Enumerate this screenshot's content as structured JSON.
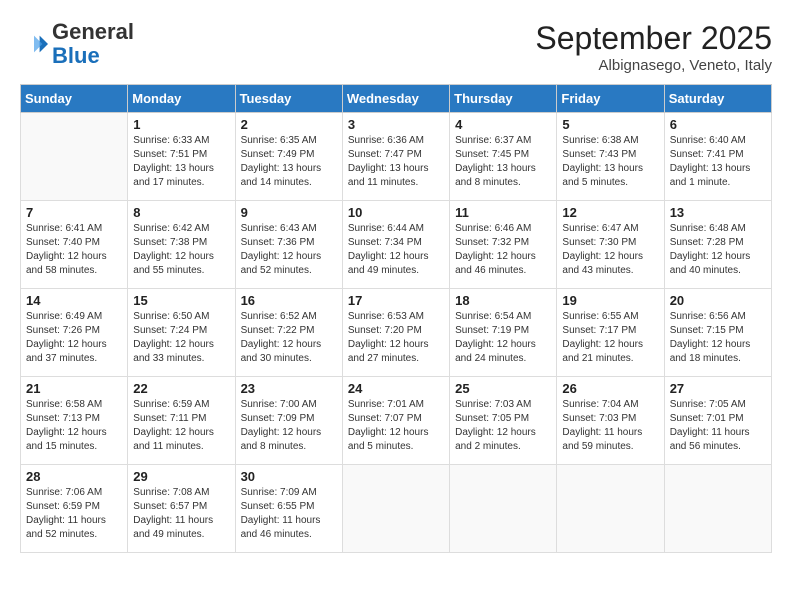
{
  "header": {
    "logo_general": "General",
    "logo_blue": "Blue",
    "month_title": "September 2025",
    "subtitle": "Albignasego, Veneto, Italy"
  },
  "days_of_week": [
    "Sunday",
    "Monday",
    "Tuesday",
    "Wednesday",
    "Thursday",
    "Friday",
    "Saturday"
  ],
  "weeks": [
    [
      {
        "day": "",
        "sunrise": "",
        "sunset": "",
        "daylight": ""
      },
      {
        "day": "1",
        "sunrise": "Sunrise: 6:33 AM",
        "sunset": "Sunset: 7:51 PM",
        "daylight": "Daylight: 13 hours and 17 minutes."
      },
      {
        "day": "2",
        "sunrise": "Sunrise: 6:35 AM",
        "sunset": "Sunset: 7:49 PM",
        "daylight": "Daylight: 13 hours and 14 minutes."
      },
      {
        "day": "3",
        "sunrise": "Sunrise: 6:36 AM",
        "sunset": "Sunset: 7:47 PM",
        "daylight": "Daylight: 13 hours and 11 minutes."
      },
      {
        "day": "4",
        "sunrise": "Sunrise: 6:37 AM",
        "sunset": "Sunset: 7:45 PM",
        "daylight": "Daylight: 13 hours and 8 minutes."
      },
      {
        "day": "5",
        "sunrise": "Sunrise: 6:38 AM",
        "sunset": "Sunset: 7:43 PM",
        "daylight": "Daylight: 13 hours and 5 minutes."
      },
      {
        "day": "6",
        "sunrise": "Sunrise: 6:40 AM",
        "sunset": "Sunset: 7:41 PM",
        "daylight": "Daylight: 13 hours and 1 minute."
      }
    ],
    [
      {
        "day": "7",
        "sunrise": "Sunrise: 6:41 AM",
        "sunset": "Sunset: 7:40 PM",
        "daylight": "Daylight: 12 hours and 58 minutes."
      },
      {
        "day": "8",
        "sunrise": "Sunrise: 6:42 AM",
        "sunset": "Sunset: 7:38 PM",
        "daylight": "Daylight: 12 hours and 55 minutes."
      },
      {
        "day": "9",
        "sunrise": "Sunrise: 6:43 AM",
        "sunset": "Sunset: 7:36 PM",
        "daylight": "Daylight: 12 hours and 52 minutes."
      },
      {
        "day": "10",
        "sunrise": "Sunrise: 6:44 AM",
        "sunset": "Sunset: 7:34 PM",
        "daylight": "Daylight: 12 hours and 49 minutes."
      },
      {
        "day": "11",
        "sunrise": "Sunrise: 6:46 AM",
        "sunset": "Sunset: 7:32 PM",
        "daylight": "Daylight: 12 hours and 46 minutes."
      },
      {
        "day": "12",
        "sunrise": "Sunrise: 6:47 AM",
        "sunset": "Sunset: 7:30 PM",
        "daylight": "Daylight: 12 hours and 43 minutes."
      },
      {
        "day": "13",
        "sunrise": "Sunrise: 6:48 AM",
        "sunset": "Sunset: 7:28 PM",
        "daylight": "Daylight: 12 hours and 40 minutes."
      }
    ],
    [
      {
        "day": "14",
        "sunrise": "Sunrise: 6:49 AM",
        "sunset": "Sunset: 7:26 PM",
        "daylight": "Daylight: 12 hours and 37 minutes."
      },
      {
        "day": "15",
        "sunrise": "Sunrise: 6:50 AM",
        "sunset": "Sunset: 7:24 PM",
        "daylight": "Daylight: 12 hours and 33 minutes."
      },
      {
        "day": "16",
        "sunrise": "Sunrise: 6:52 AM",
        "sunset": "Sunset: 7:22 PM",
        "daylight": "Daylight: 12 hours and 30 minutes."
      },
      {
        "day": "17",
        "sunrise": "Sunrise: 6:53 AM",
        "sunset": "Sunset: 7:20 PM",
        "daylight": "Daylight: 12 hours and 27 minutes."
      },
      {
        "day": "18",
        "sunrise": "Sunrise: 6:54 AM",
        "sunset": "Sunset: 7:19 PM",
        "daylight": "Daylight: 12 hours and 24 minutes."
      },
      {
        "day": "19",
        "sunrise": "Sunrise: 6:55 AM",
        "sunset": "Sunset: 7:17 PM",
        "daylight": "Daylight: 12 hours and 21 minutes."
      },
      {
        "day": "20",
        "sunrise": "Sunrise: 6:56 AM",
        "sunset": "Sunset: 7:15 PM",
        "daylight": "Daylight: 12 hours and 18 minutes."
      }
    ],
    [
      {
        "day": "21",
        "sunrise": "Sunrise: 6:58 AM",
        "sunset": "Sunset: 7:13 PM",
        "daylight": "Daylight: 12 hours and 15 minutes."
      },
      {
        "day": "22",
        "sunrise": "Sunrise: 6:59 AM",
        "sunset": "Sunset: 7:11 PM",
        "daylight": "Daylight: 12 hours and 11 minutes."
      },
      {
        "day": "23",
        "sunrise": "Sunrise: 7:00 AM",
        "sunset": "Sunset: 7:09 PM",
        "daylight": "Daylight: 12 hours and 8 minutes."
      },
      {
        "day": "24",
        "sunrise": "Sunrise: 7:01 AM",
        "sunset": "Sunset: 7:07 PM",
        "daylight": "Daylight: 12 hours and 5 minutes."
      },
      {
        "day": "25",
        "sunrise": "Sunrise: 7:03 AM",
        "sunset": "Sunset: 7:05 PM",
        "daylight": "Daylight: 12 hours and 2 minutes."
      },
      {
        "day": "26",
        "sunrise": "Sunrise: 7:04 AM",
        "sunset": "Sunset: 7:03 PM",
        "daylight": "Daylight: 11 hours and 59 minutes."
      },
      {
        "day": "27",
        "sunrise": "Sunrise: 7:05 AM",
        "sunset": "Sunset: 7:01 PM",
        "daylight": "Daylight: 11 hours and 56 minutes."
      }
    ],
    [
      {
        "day": "28",
        "sunrise": "Sunrise: 7:06 AM",
        "sunset": "Sunset: 6:59 PM",
        "daylight": "Daylight: 11 hours and 52 minutes."
      },
      {
        "day": "29",
        "sunrise": "Sunrise: 7:08 AM",
        "sunset": "Sunset: 6:57 PM",
        "daylight": "Daylight: 11 hours and 49 minutes."
      },
      {
        "day": "30",
        "sunrise": "Sunrise: 7:09 AM",
        "sunset": "Sunset: 6:55 PM",
        "daylight": "Daylight: 11 hours and 46 minutes."
      },
      {
        "day": "",
        "sunrise": "",
        "sunset": "",
        "daylight": ""
      },
      {
        "day": "",
        "sunrise": "",
        "sunset": "",
        "daylight": ""
      },
      {
        "day": "",
        "sunrise": "",
        "sunset": "",
        "daylight": ""
      },
      {
        "day": "",
        "sunrise": "",
        "sunset": "",
        "daylight": ""
      }
    ]
  ]
}
